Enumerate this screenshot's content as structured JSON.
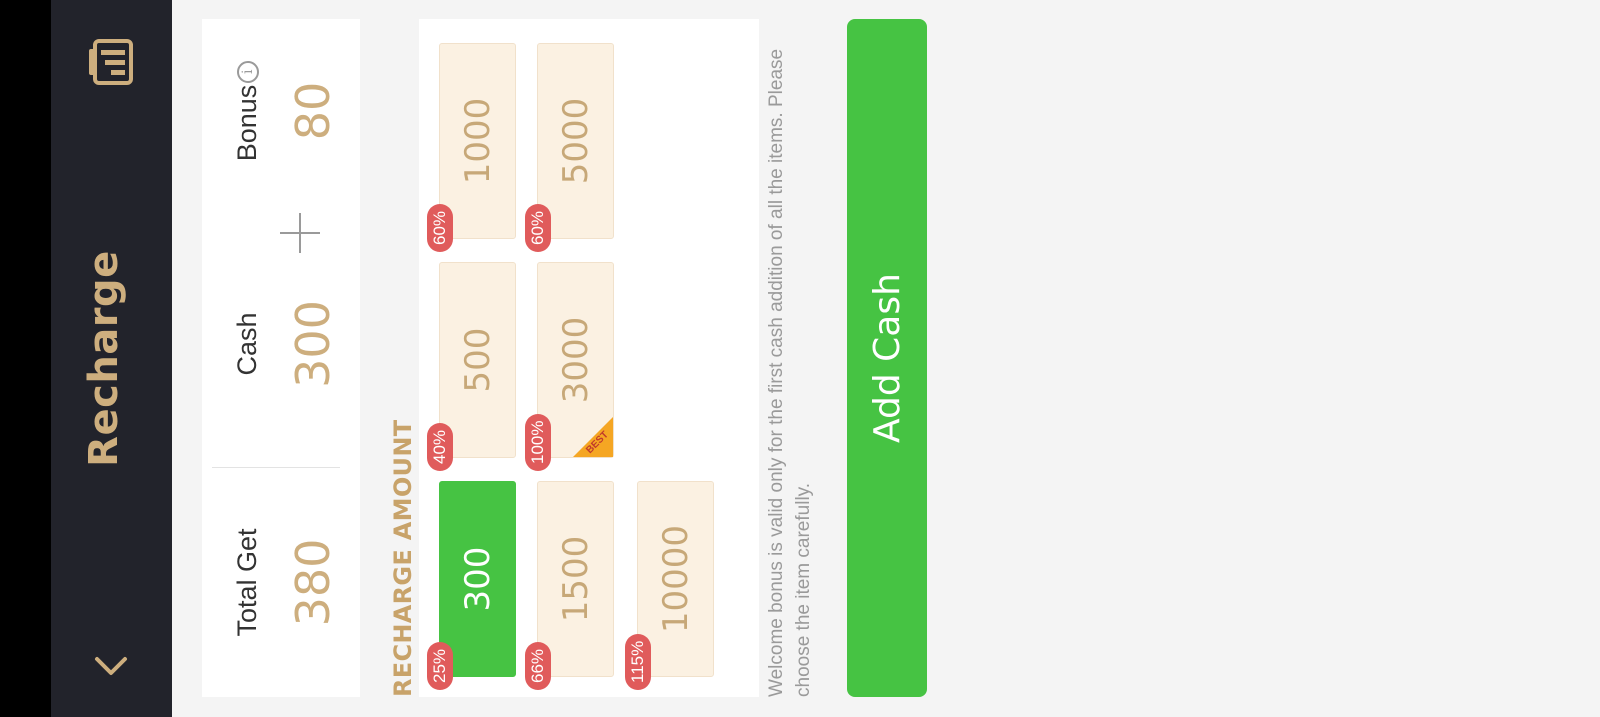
{
  "header": {
    "title": "Recharge",
    "back_icon": "chevron-left-icon",
    "record_icon": "records-icon"
  },
  "summary": {
    "total_label": "Total Get",
    "total_value": "380",
    "cash_label": "Cash",
    "cash_value": "300",
    "bonus_label": "Bonus",
    "bonus_value": "80",
    "info_glyph": "i"
  },
  "section_title": "RECHARGE AMOUNT",
  "amounts": [
    {
      "value": "300",
      "badge": "25%",
      "selected": true
    },
    {
      "value": "500",
      "badge": "40%"
    },
    {
      "value": "1000",
      "badge": "60%"
    },
    {
      "value": "1500",
      "badge": "66%"
    },
    {
      "value": "3000",
      "badge": "100%",
      "tag": "BEST"
    },
    {
      "value": "5000",
      "badge": "60%"
    },
    {
      "value": "10000",
      "badge": "115%"
    }
  ],
  "note": "Welcome bonus is valid only for the first cash addition of all the items. Please choose the item carefully.",
  "add_cash_label": "Add Cash",
  "colors": {
    "accent_gold": "#cdae7e",
    "button_green": "#46c343",
    "badge_red": "#e05b5b",
    "header_dark": "#22232b"
  }
}
